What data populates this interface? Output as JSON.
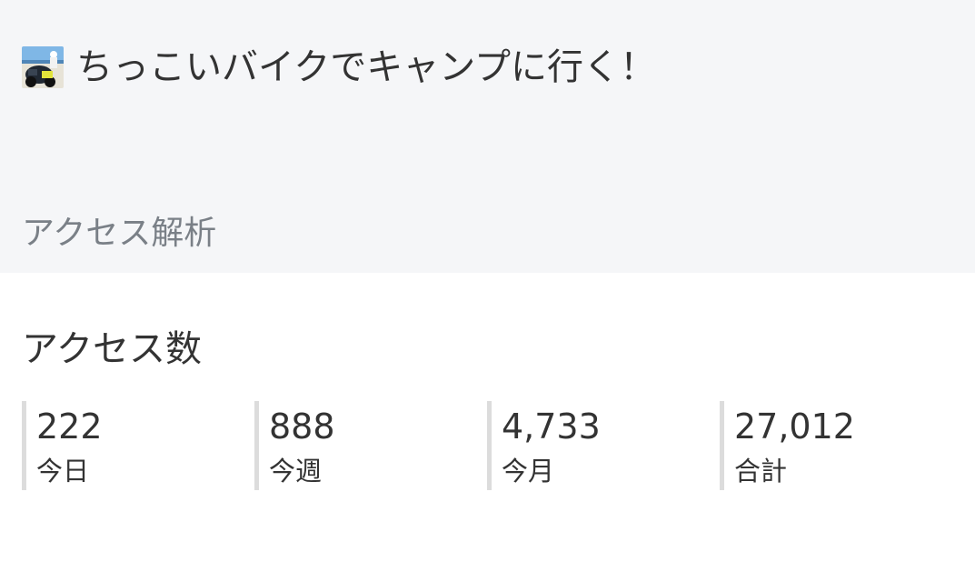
{
  "blog": {
    "title": "ちっこいバイクでキャンプに行く！",
    "avatar_icon": "blog-avatar-photo"
  },
  "page": {
    "section_label": "アクセス解析",
    "heading": "アクセス数"
  },
  "stats": [
    {
      "value": "222",
      "label": "今日"
    },
    {
      "value": "888",
      "label": "今週"
    },
    {
      "value": "4,733",
      "label": "今月"
    },
    {
      "value": "27,012",
      "label": "合計"
    }
  ],
  "colors": {
    "top_background": "#f5f6f8",
    "text": "#333333",
    "muted_text": "#7a8087",
    "stat_divider": "#dcdcdc"
  }
}
